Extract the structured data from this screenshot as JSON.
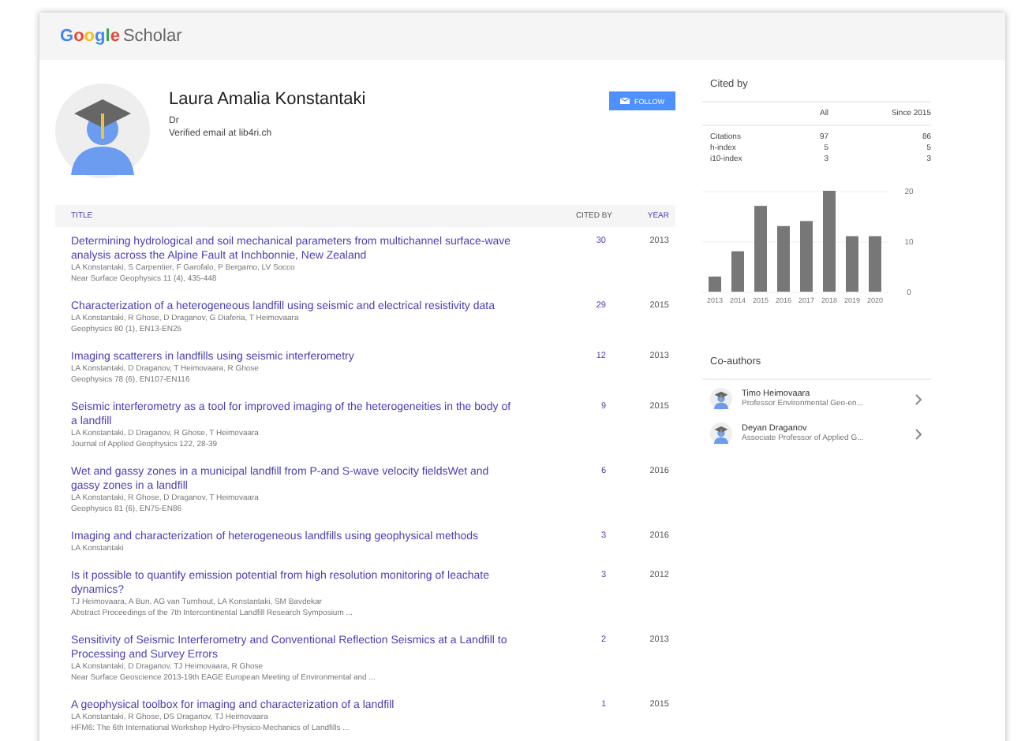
{
  "header": {
    "logo_brand": "Google",
    "logo_product": "Scholar"
  },
  "profile": {
    "name": "Laura Amalia Konstantaki",
    "title": "Dr",
    "email": "Verified email at lib4ri.ch",
    "follow_button": "FOLLOW"
  },
  "table": {
    "columns": [
      "TITLE",
      "CITED BY",
      "YEAR"
    ],
    "rows": [
      {
        "title": "Determining hydrological and soil mechanical parameters from multichannel surface-wave analysis across the Alpine Fault at Inchbonnie, New Zealand",
        "authors": "LA Konstantaki, S Carpentier, F Garofalo, P Bergamo, LV Socco",
        "venue": "Near Surface Geophysics 11 (4), 435-448",
        "cited_by": "30",
        "year": "2013"
      },
      {
        "title": "Characterization of a heterogeneous landfill using seismic and electrical resistivity data",
        "authors": "LA Konstantaki, R Ghose, D Draganov, G Diaferia, T Heimovaara",
        "venue": "Geophysics 80 (1), EN13-EN25",
        "cited_by": "29",
        "year": "2015"
      },
      {
        "title": "Imaging scatterers in landfills using seismic interferometry",
        "authors": "LA Konstantaki, D Draganov, T Heimovaara, R Ghose",
        "venue": "Geophysics 78 (6), EN107-EN116",
        "cited_by": "12",
        "year": "2013"
      },
      {
        "title": "Seismic interferometry as a tool for improved imaging of the heterogeneities in the body of a landfill",
        "authors": "LA Konstantaki, D Draganov, R Ghose, T Heimovaara",
        "venue": "Journal of Applied Geophysics 122, 28-39",
        "cited_by": "9",
        "year": "2015"
      },
      {
        "title": "Wet and gassy zones in a municipal landfill from P-and S-wave velocity fieldsWet and gassy zones in a landfill",
        "authors": "LA Konstantaki, R Ghose, D Draganov, T Heimovaara",
        "venue": "Geophysics 81 (6), EN75-EN86",
        "cited_by": "6",
        "year": "2016"
      },
      {
        "title": "Imaging and characterization of heterogeneous landfills using geophysical methods",
        "authors": "LA Konstantaki",
        "cited_by": "3",
        "year": "2016"
      },
      {
        "title": "Is it possible to quantify emission potential from high resolution monitoring of leachate dynamics?",
        "authors": "TJ Heimovaara, A Bun, AG van Turnhout, LA Konstantaki, SM Bavdekar",
        "venue": "Abstract Proceedings of the 7th Intercontinental Landfill Research Symposium ...",
        "cited_by": "3",
        "year": "2012"
      },
      {
        "title": "Sensitivity of Seismic Interferometry and Conventional Reflection Seismics at a Landfill to Processing and Survey Errors",
        "authors": "LA Konstantaki, D Draganov, TJ Heimovaara, R Ghose",
        "venue": "Near Surface Geoscience 2013-19th EAGE European Meeting of Environmental and ...",
        "cited_by": "2",
        "year": "2013"
      },
      {
        "title": "A geophysical toolbox for imaging and characterization of a landfill",
        "authors": "LA Konstantaki, R Ghose, DS Draganov, TJ Heimovaara",
        "venue": "HFM6: The 6th International Workshop Hydro-Physico-Mechanics of Landfills ...",
        "cited_by": "1",
        "year": "2015"
      }
    ]
  },
  "cited_by": {
    "title": "Cited by",
    "columns": [
      "All",
      "Since 2015"
    ],
    "rows": [
      {
        "label": "Citations",
        "all": "97",
        "since": "86"
      },
      {
        "label": "h-index",
        "all": "5",
        "since": "5"
      },
      {
        "label": "i10-index",
        "all": "3",
        "since": "3"
      }
    ],
    "chart_data": {
      "type": "bar",
      "categories": [
        "2013",
        "2014",
        "2015",
        "2016",
        "2017",
        "2018",
        "2019",
        "2020"
      ],
      "values": [
        3,
        8,
        17,
        13,
        14,
        20,
        11,
        11
      ],
      "ylim": [
        0,
        20
      ],
      "yticks": [
        0,
        10,
        20
      ]
    }
  },
  "coauthors": {
    "title": "Co-authors",
    "items": [
      {
        "name": "Timo Heimovaara",
        "affiliation": "Professor Environmental Geo-en..."
      },
      {
        "name": "Deyan Draganov",
        "affiliation": "Associate Professor of Applied G..."
      }
    ]
  }
}
